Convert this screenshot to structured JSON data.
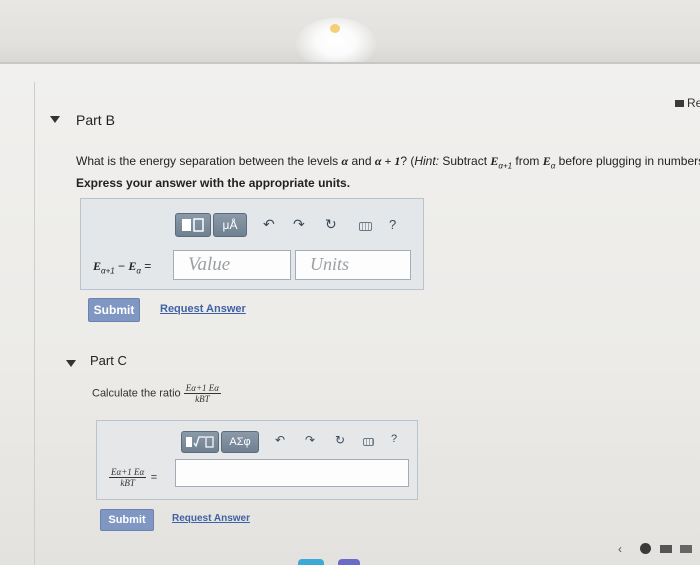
{
  "header": {
    "right_label": "Re"
  },
  "partB": {
    "title": "Part B",
    "question_pre": "What is the energy separation between the levels ",
    "alpha1": "α",
    "question_mid": " and ",
    "alpha2": "α + 1",
    "question_q": "? (",
    "hint_label": "Hint:",
    "hint_text1": " Subtract ",
    "e_a1": "E",
    "sub_a1": "α+1",
    "hint_text2": " from ",
    "e_a": "E",
    "sub_a": "α",
    "hint_text3": " before plugging in numbers.)",
    "instruction": "Express your answer with the appropriate units.",
    "toolbar": {
      "templates": "▮◻",
      "units": "μÅ",
      "help": "?"
    },
    "label": {
      "e1": "E",
      "s1": "α+1",
      "minus": " − ",
      "e2": "E",
      "s2": "α",
      "eq": " ="
    },
    "value_placeholder": "Value",
    "units_placeholder": "Units",
    "submit": "Submit",
    "request": "Request Answer"
  },
  "partC": {
    "title": "Part C",
    "prompt": "Calculate the ratio",
    "ratio_num": "Eα+1  Eα",
    "ratio_den": "kBT",
    "toolbar": {
      "templates": "▮√◻",
      "symbols": "ΑΣφ",
      "help": "?"
    },
    "eq": "=",
    "submit": "Submit",
    "request": "Request Answer"
  },
  "colors": {
    "accent": "#7f97c2",
    "link": "#3f61a6",
    "toolbar": "#7d8d9d"
  }
}
